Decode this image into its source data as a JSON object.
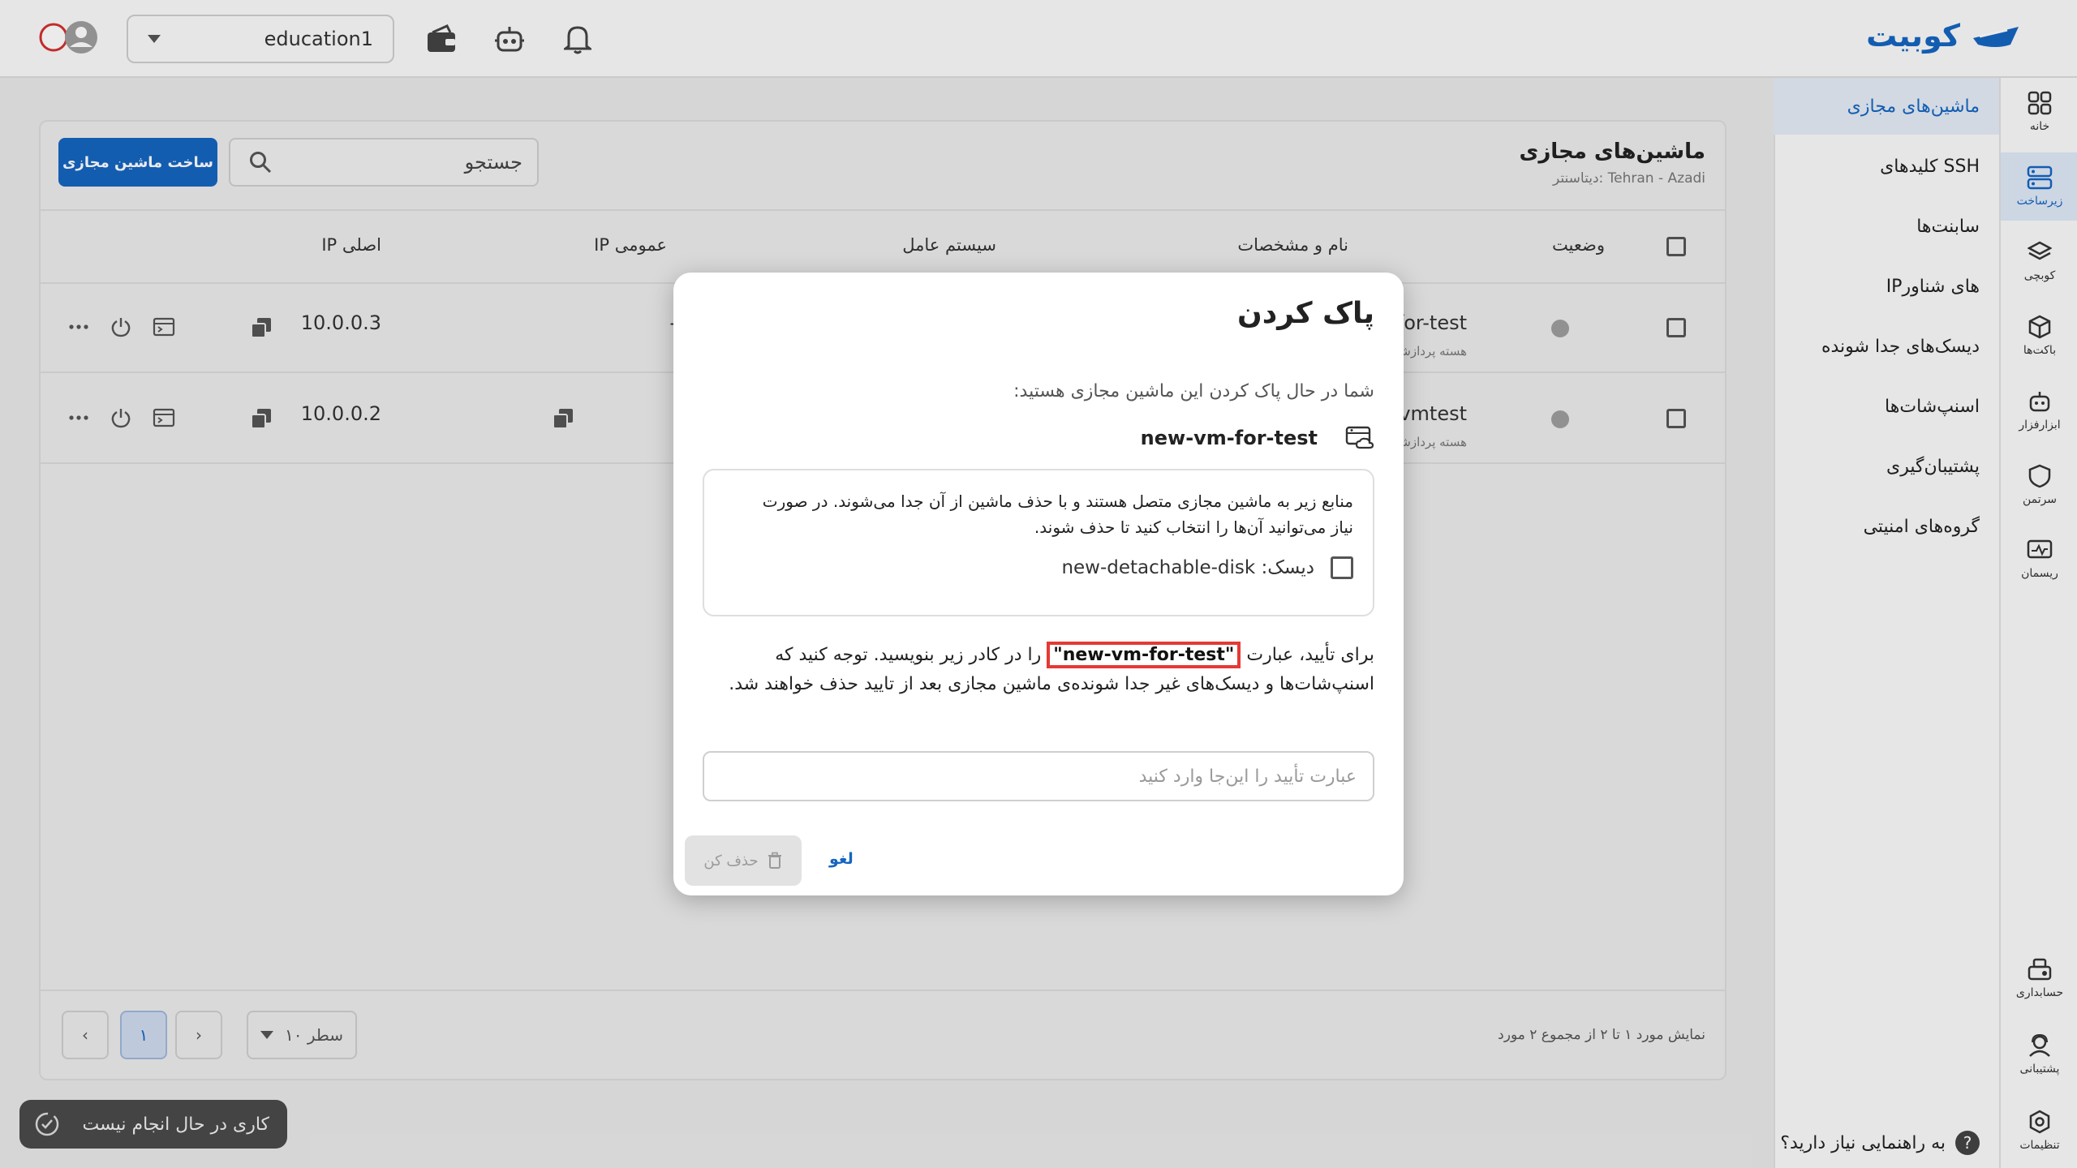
{
  "app": {
    "brand": "کوبیت",
    "workspace": "education1"
  },
  "sidebar": {
    "icons": [
      {
        "label": "خانه",
        "icon": "grid-icon"
      },
      {
        "label": "زیرساخت",
        "icon": "server-icon",
        "active": true
      },
      {
        "label": "کوبچی",
        "icon": "layers-icon"
      },
      {
        "label": "باکت‌ها",
        "icon": "cube-icon"
      },
      {
        "label": "ابزارفزار",
        "icon": "robot-icon"
      },
      {
        "label": "سرتمن",
        "icon": "shield-icon"
      },
      {
        "label": "ریسمان",
        "icon": "monitor-icon"
      }
    ],
    "bottom_icons": [
      {
        "label": "حسابداری",
        "icon": "accounting-icon"
      },
      {
        "label": "پشتیبانی",
        "icon": "support-icon"
      },
      {
        "label": "تنظیمات",
        "icon": "settings-icon"
      }
    ],
    "menu": [
      {
        "label": "ماشین‌های مجازی",
        "active": true
      },
      {
        "label": "کلیدهای SSH"
      },
      {
        "label": "سابنت‌ها"
      },
      {
        "label": "IPهای شناور"
      },
      {
        "label": "دیسک‌های جدا شونده"
      },
      {
        "label": "اسنپ‌شات‌ها"
      },
      {
        "label": "پشتیبان‌گیری"
      },
      {
        "label": "گروه‌های امنیتی"
      }
    ],
    "help": "به راهنمایی نیاز دارید؟",
    "help_glyph": "?"
  },
  "page": {
    "title": "ماشین‌های مجازی",
    "datacenter": "دیتاسنتر: Tehran - Azadi",
    "create_button": "ساخت ماشین مجازی",
    "search_placeholder": "جستجو"
  },
  "table": {
    "headers": {
      "status": "وضعیت",
      "name": "نام و مشخصات",
      "os": "سیستم عامل",
      "public_ip": "IP عمومی",
      "private_ip": "IP اصلی"
    },
    "rows": [
      {
        "name": "new-vm-for-test",
        "spec": "۱ هسته پردازشی",
        "public_ip": "-",
        "private_ip": "10.0.0.3"
      },
      {
        "name": "vmtest",
        "spec": "۱ هسته پردازشی",
        "public_ip": "",
        "private_ip": "10.0.0.2"
      }
    ]
  },
  "pagination": {
    "info": "نمایش مورد ۱ تا ۲ از مجموع ۲ مورد",
    "rows_per_page": "۱۰ سطر",
    "current_page": "۱",
    "prev": "‹",
    "next": "›"
  },
  "toast": {
    "text": "کاری در حال انجام نیست"
  },
  "modal": {
    "title": "پاک کردن",
    "lead": "شما در حال پاک کردن این ماشین مجازی هستید:",
    "vm_name": "new-vm-for-test",
    "resources_text": "منابع زیر به ماشین مجازی متصل هستند و با حذف ماشین از آن جدا می‌شوند. در صورت نیاز می‌توانید آن‌ها را انتخاب کنید تا حذف شوند.",
    "disk_label": "دیسک: new-detachable-disk",
    "confirm_before": "برای تأیید، عبارت",
    "confirm_phrase": "\"new-vm-for-test\"",
    "confirm_after": "را در کادر زیر بنویسید. توجه کنید که اسنپ‌شات‌ها و دیسک‌های غیر جدا شونده‌ی ماشین مجازی بعد از تایید حذف خواهند شد.",
    "input_placeholder": "عبارت تأیید را این‌جا وارد کنید",
    "delete_button": "حذف کن",
    "cancel_button": "لغو"
  },
  "colors": {
    "primary": "#1565c0",
    "highlight_border": "#e53935",
    "toast_bg": "#4a4a4a"
  }
}
